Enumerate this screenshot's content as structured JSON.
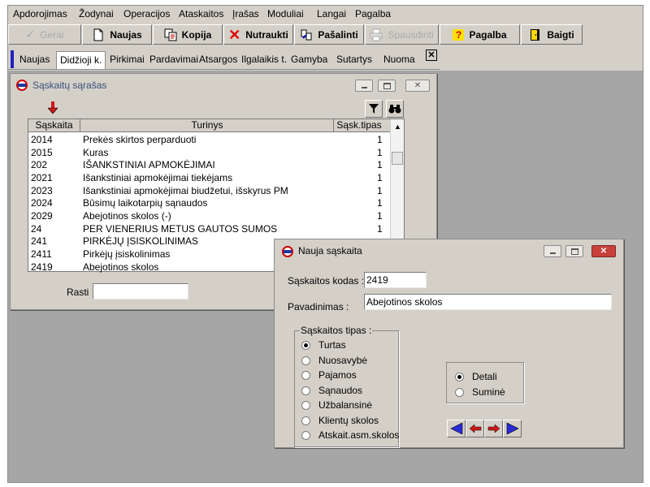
{
  "menu": [
    "Apdorojimas",
    "Žodynai",
    "Operacijos",
    "Ataskaitos",
    "Įrašas",
    "Moduliai",
    "Langai",
    "Pagalba"
  ],
  "toolbar": {
    "gerai": "Gerai",
    "naujas": "Naujas",
    "kopija": "Kopija",
    "nutraukti": "Nutraukti",
    "pasalinti": "Pašalinti",
    "spausdinti": "Spausdinti",
    "pagalba": "Pagalba",
    "baigti": "Baigti"
  },
  "tabs": [
    "Naujas",
    "Didžioji k.",
    "Pirkimai",
    "Pardavimai",
    "Atsargos",
    "Ilgalaikis t.",
    "Gamyba",
    "Sutartys",
    "Nuoma"
  ],
  "tabs_close": "✕",
  "list_window": {
    "title": "Sąskaitų sąrašas",
    "columns": [
      "Sąskaita",
      "Turinys",
      "Sąsk.tipas"
    ],
    "rows": [
      {
        "code": "2014",
        "name": "Prekės skirtos perparduoti",
        "type": "1"
      },
      {
        "code": "2015",
        "name": "Kuras",
        "type": "1"
      },
      {
        "code": "202",
        "name": "IŠANKSTINIAI APMOKĖJIMAI",
        "type": "1"
      },
      {
        "code": "2021",
        "name": "Išankstiniai apmokėjimai tiekėjams",
        "type": "1"
      },
      {
        "code": "2023",
        "name": "Išankstiniai apmokėjimai biudžetui, išskyrus PM",
        "type": "1"
      },
      {
        "code": "2024",
        "name": "Būsimų laikotarpių sąnaudos",
        "type": "1"
      },
      {
        "code": "2029",
        "name": "Abejotinos skolos (-)",
        "type": "1"
      },
      {
        "code": "24",
        "name": "PER VIENERIUS METUS GAUTOS SUMOS",
        "type": "1"
      },
      {
        "code": "241",
        "name": "PIRKĖJŲ ĮSISKOLINIMAS",
        "type": ""
      },
      {
        "code": "2411",
        "name": "Pirkėjų įsiskolinimas",
        "type": ""
      },
      {
        "code": "2419",
        "name": "Abejotinos skolos",
        "type": ""
      }
    ],
    "search_label": "Rasti",
    "search_value": ""
  },
  "dialog": {
    "title": "Nauja sąskaita",
    "code_label": "Sąskaitos kodas :",
    "code_value": "2419",
    "name_label": "Pavadinimas :",
    "name_value": "Abejotinos skolos",
    "type_group_label": "Sąskaitos tipas :",
    "types": [
      "Turtas",
      "Nuosavybė",
      "Pajamos",
      "Sąnaudos",
      "Užbalansinė",
      "Klientų skolos",
      "Atskait.asm.skolos"
    ],
    "types_selected": 0,
    "detail_options": [
      "Detali",
      "Suminė"
    ],
    "detail_selected": 0
  },
  "colors": {
    "accent_blue": "#2a2ad8",
    "nav_red": "#d01818",
    "mdi_bg": "#a6a6a6",
    "face": "#d4d0c8"
  }
}
